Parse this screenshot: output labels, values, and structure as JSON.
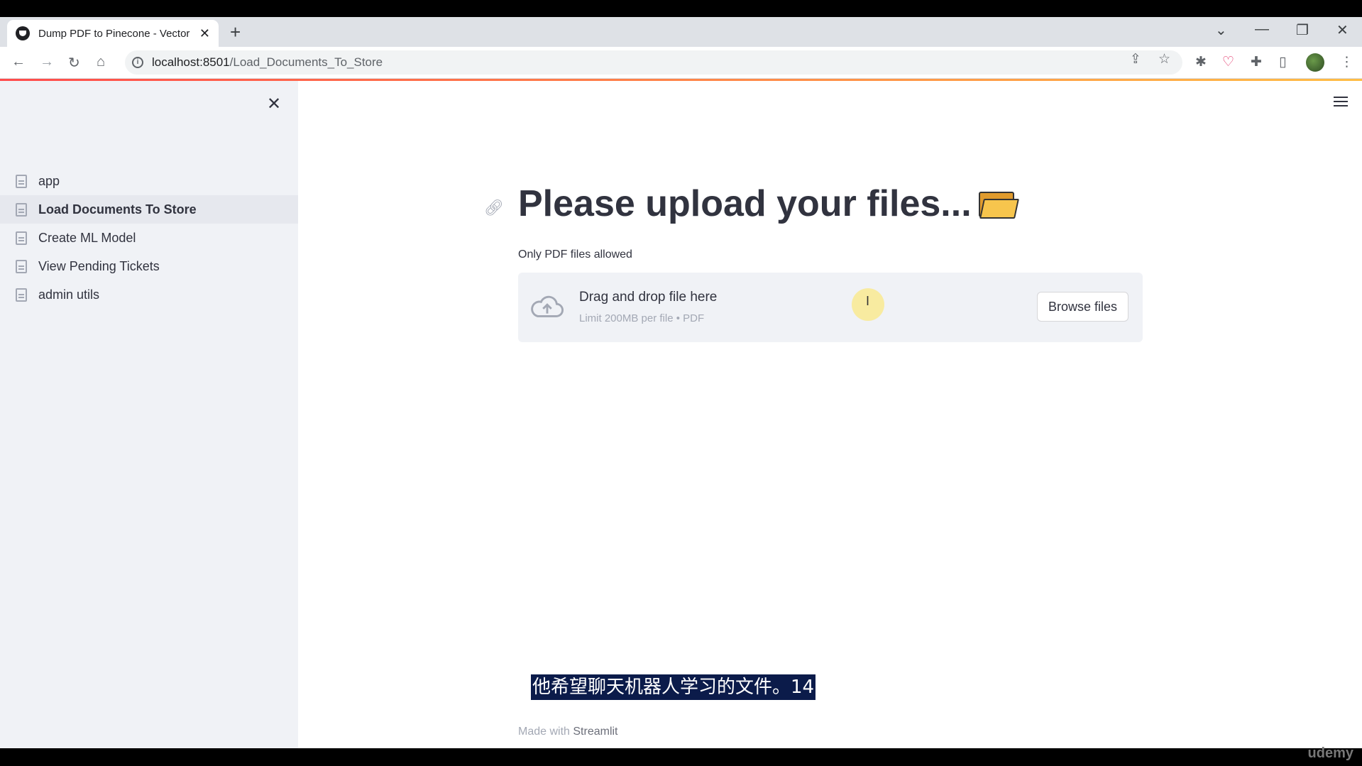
{
  "browser": {
    "tab_title": "Dump PDF to Pinecone - Vector",
    "url_host": "localhost:8501",
    "url_path": "/Load_Documents_To_Store"
  },
  "sidebar": {
    "items": [
      {
        "label": "app",
        "active": false
      },
      {
        "label": "Load Documents To Store",
        "active": true
      },
      {
        "label": "Create ML Model",
        "active": false
      },
      {
        "label": "View Pending Tickets",
        "active": false
      },
      {
        "label": "admin utils",
        "active": false
      }
    ]
  },
  "main": {
    "title": "Please upload your files...",
    "file_label": "Only PDF files allowed",
    "drop_main": "Drag and drop file here",
    "drop_sub": "Limit 200MB per file • PDF",
    "browse_label": "Browse files",
    "footer_prefix": "Made with",
    "footer_brand": "Streamlit"
  },
  "overlay": {
    "subtitle": "他希望聊天机器人学习的文件。14",
    "watermark": "udemy"
  },
  "colors": {
    "accent_red": "#ff4b4b",
    "sidebar_bg": "#f0f2f6",
    "text": "#31333f"
  },
  "icons": [
    "page-icon",
    "close-icon",
    "hamburger-icon",
    "link-icon",
    "folder-icon",
    "cloud-upload-icon"
  ]
}
